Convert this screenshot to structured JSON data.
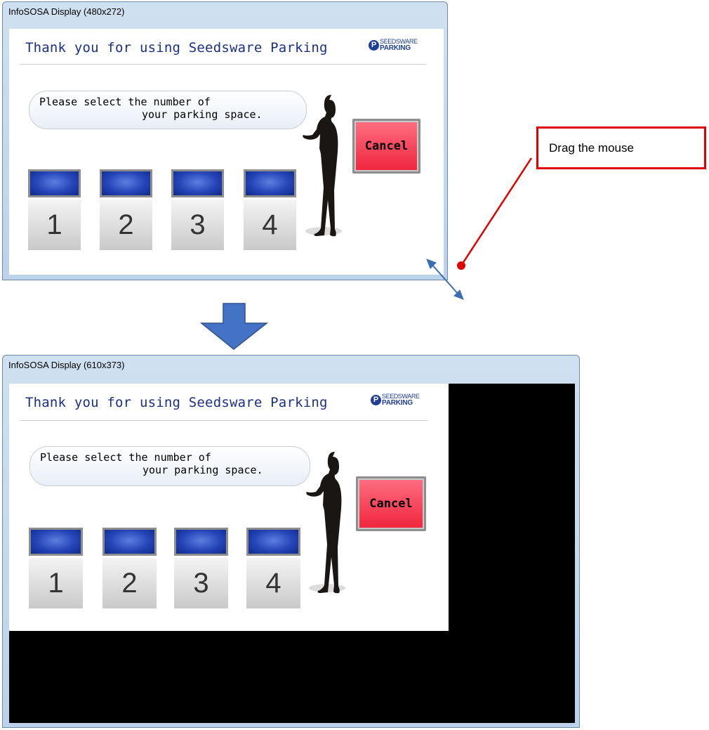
{
  "windows": [
    {
      "title": "InfoSOSA Display (480x272)",
      "heading": "Thank you for using Seedsware Parking",
      "logo_top": "SEEDSWARE",
      "logo_bottom": "PARKING",
      "prompt_line1": "Please select the number of",
      "prompt_line2": "your parking space.",
      "cancel_label": "Cancel",
      "spaces": [
        "1",
        "2",
        "3",
        "4"
      ]
    },
    {
      "title": "InfoSOSA Display (610x373)",
      "heading": "Thank you for using Seedsware Parking",
      "logo_top": "SEEDSWARE",
      "logo_bottom": "PARKING",
      "prompt_line1": "Please select the number of",
      "prompt_line2": "your parking space.",
      "cancel_label": "Cancel",
      "spaces": [
        "1",
        "2",
        "3",
        "4"
      ]
    }
  ],
  "annotation": {
    "label": "Drag the mouse"
  },
  "colors": {
    "heading": "#1a2f8a",
    "cancel": "#f0243d",
    "annotation": "#e00000",
    "arrow": "#3c6eb4"
  },
  "icons": {
    "resize": "diagonal-resize-arrow-icon",
    "transition": "down-arrow-icon",
    "figure": "woman-silhouette-icon"
  }
}
